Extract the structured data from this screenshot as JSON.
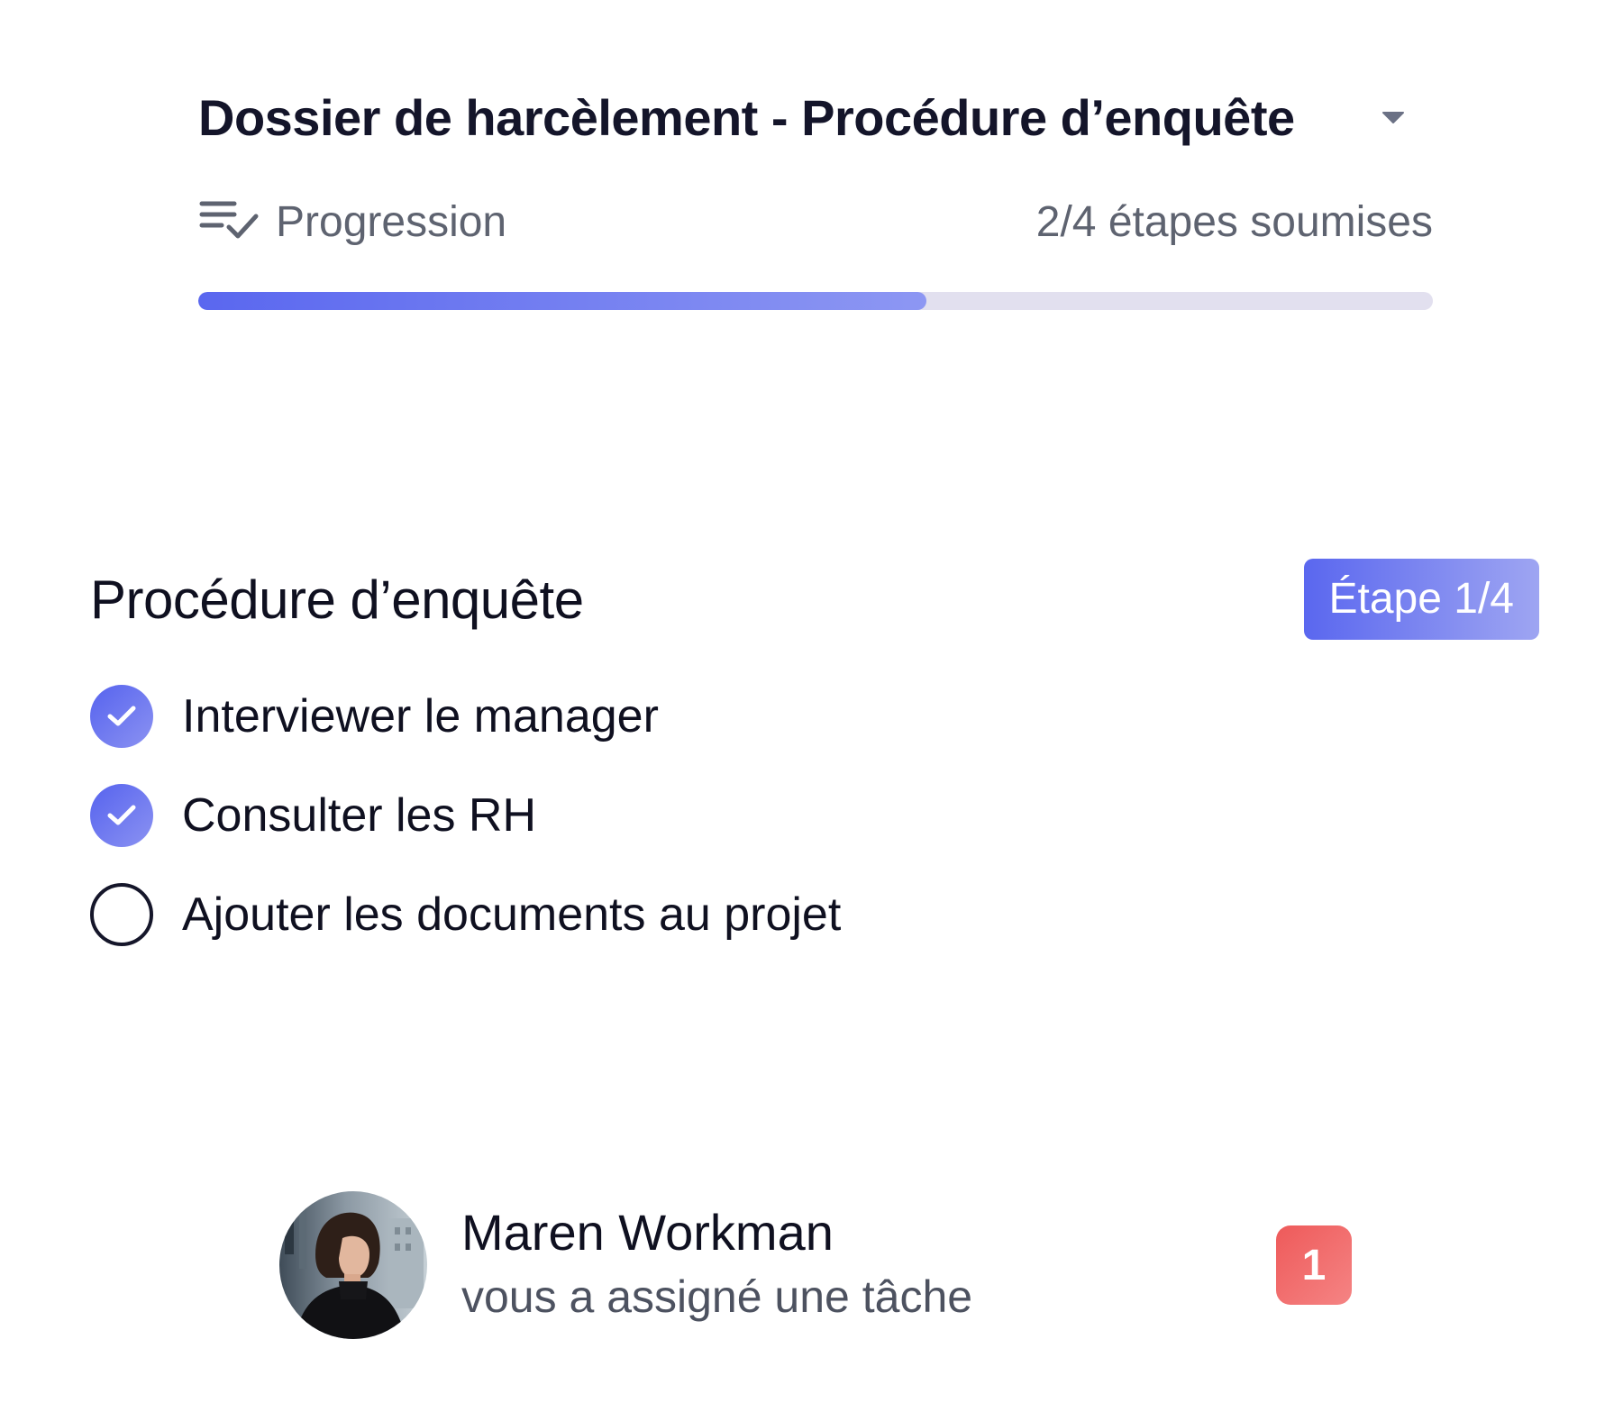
{
  "header": {
    "title": "Dossier de harcèlement - Procédure d’enquête",
    "dropdown_icon": "caret-down-icon"
  },
  "progress": {
    "icon": "checklist-icon",
    "label": "Progression",
    "count_text": "2/4 étapes soumises",
    "completed": 2,
    "total": 4,
    "fraction": 0.59,
    "fill_color_start": "#5a67ef",
    "fill_color_end": "#8d97f3",
    "track_color": "#e2e0ef"
  },
  "procedure": {
    "title": "Procédure d’enquête",
    "step_badge": "Étape 1/4",
    "tasks": [
      {
        "label": "Interviewer le manager",
        "done": true
      },
      {
        "label": "Consulter les RH",
        "done": true
      },
      {
        "label": "Ajouter les documents au projet",
        "done": false
      }
    ]
  },
  "notification": {
    "name": "Maren Workman",
    "message": "vous a assigné une tâche",
    "badge_count": "1",
    "badge_color": "#ee5a5a",
    "accent": "#5a67ef"
  }
}
